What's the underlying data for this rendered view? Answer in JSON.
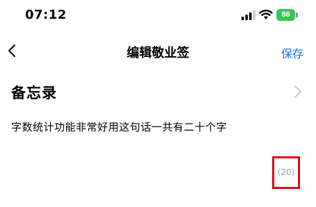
{
  "status_bar": {
    "time": "07:12",
    "battery_level": "86"
  },
  "nav": {
    "title": "编辑敬业签",
    "save_label": "保存"
  },
  "note": {
    "title": "备忘录",
    "content": "字数统计功能非常好用这句话一共有二十个字",
    "char_count": "(20)"
  },
  "colors": {
    "accent": "#1a73e8",
    "battery": "#34c759",
    "highlight_border": "#e60012",
    "count_text": "#9e9e9e"
  }
}
